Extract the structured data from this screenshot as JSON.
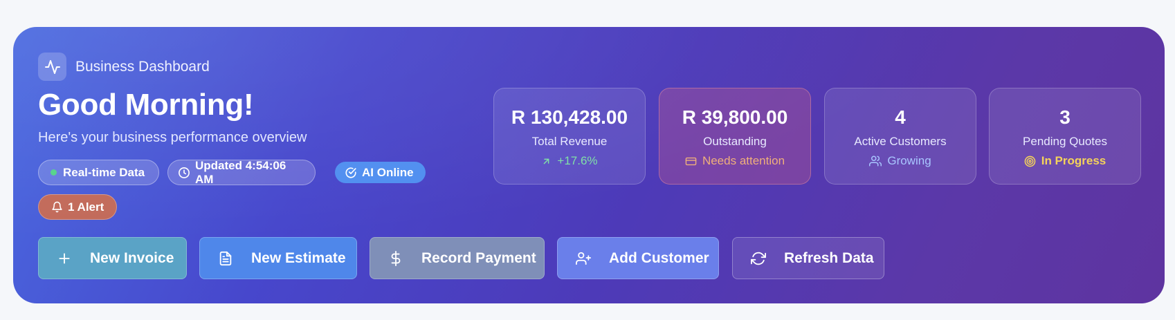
{
  "header": {
    "brand_name": "Business Dashboard",
    "greeting": "Good Morning!",
    "subtitle": "Here's your business performance overview"
  },
  "badges": {
    "realtime": "Real-time Data",
    "updated": "Updated 4:54:06 AM",
    "ai": "AI Online",
    "alert": "1 Alert"
  },
  "stats": {
    "revenue": {
      "value": "R 130,428.00",
      "label": "Total Revenue",
      "sub": "+17.6%",
      "sub_color": "#7fe0a6"
    },
    "outstanding": {
      "value": "R 39,800.00",
      "label": "Outstanding",
      "sub": "Needs attention",
      "sub_color": "#f0b07a"
    },
    "customers": {
      "value": "4",
      "label": "Active Customers",
      "sub": "Growing",
      "sub_color": "#a9c6ff"
    },
    "quotes": {
      "value": "3",
      "label": "Pending Quotes",
      "sub": "In Progress",
      "sub_color": "#f5d35a"
    }
  },
  "actions": {
    "new_invoice": "New Invoice",
    "new_estimate": "New Estimate",
    "record_payment": "Record Payment",
    "add_customer": "Add Customer",
    "refresh_data": "Refresh Data"
  },
  "icons": {
    "brand": "activity-icon",
    "updated": "clock-icon",
    "ai": "check-circle-icon",
    "alert": "bell-icon",
    "revenue": "arrow-up-right-icon",
    "outstanding": "credit-card-icon",
    "customers": "users-icon",
    "quotes": "target-icon"
  }
}
